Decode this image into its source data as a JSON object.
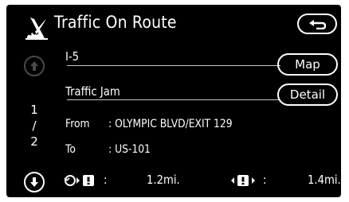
{
  "header": {
    "title": "Traffic On Route",
    "icon": "traffic-icon",
    "back_icon": "return-arrow-icon"
  },
  "pager": {
    "up_icon": "scroll-up-icon",
    "down_icon": "scroll-down-icon",
    "current": "1",
    "separator": "/",
    "total": "2"
  },
  "items": [
    {
      "label": "I-5",
      "button": "Map"
    },
    {
      "label": "Traffic Jam",
      "button": "Detail"
    }
  ],
  "details": {
    "from_label": "From",
    "from_value": ": OLYMPIC BLVD/EXIT 129",
    "to_label": "To",
    "to_value": ": US-101"
  },
  "distances": {
    "to_start_icon": "current-to-incident-icon",
    "to_start_sep": ":",
    "to_start_value": "1.2mi.",
    "length_icon": "incident-length-icon",
    "length_sep": ":",
    "length_value": "1.4mi."
  },
  "colors": {
    "background": "#000000",
    "text": "#ffffff",
    "disabled": "#4a4a4a"
  }
}
